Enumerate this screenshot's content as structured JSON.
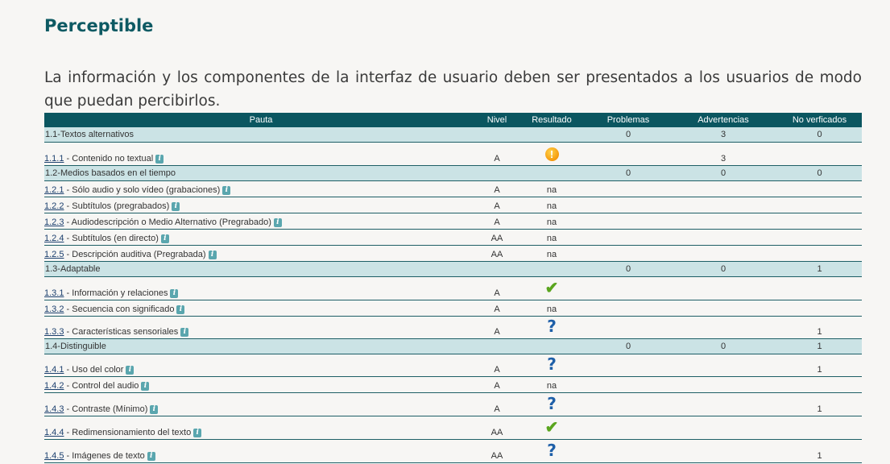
{
  "section_title": "Perceptible",
  "intro": "La información y los componentes de la interfaz de usuario deben ser presentados a los usuarios de modo que puedan percibirlos.",
  "colors": {
    "header_bg": "#0b5660",
    "group_bg": "#cbe3e5",
    "title": "#0e5a63"
  },
  "table": {
    "headers": {
      "pauta": "Pauta",
      "nivel": "Nivel",
      "resultado": "Resultado",
      "problemas": "Problemas",
      "advertencias": "Advertencias",
      "no_verificados": "No verficados"
    },
    "rows": [
      {
        "type": "group",
        "name": "1.1-Textos alternativos",
        "problemas": "0",
        "advertencias": "3",
        "no_verificados": "0"
      },
      {
        "type": "item",
        "code": "1.1.1",
        "name": " - Contenido no textual",
        "nivel": "A",
        "resultado": "",
        "icon": "warning-icon",
        "problemas": "",
        "advertencias": "3",
        "no_verificados": ""
      },
      {
        "type": "group",
        "name": "1.2-Medios basados en el tiempo",
        "problemas": "0",
        "advertencias": "0",
        "no_verificados": "0"
      },
      {
        "type": "item",
        "code": "1.2.1",
        "name": " - Sólo audio y solo vídeo (grabaciones)",
        "nivel": "A",
        "resultado": "na",
        "icon": "",
        "problemas": "",
        "advertencias": "",
        "no_verificados": ""
      },
      {
        "type": "item",
        "code": "1.2.2",
        "name": " - Subtítulos (pregrabados)",
        "nivel": "A",
        "resultado": "na",
        "icon": "",
        "problemas": "",
        "advertencias": "",
        "no_verificados": ""
      },
      {
        "type": "item",
        "code": "1.2.3",
        "name": " - Audiodescripción o Medio Alternativo (Pregrabado)",
        "nivel": "A",
        "resultado": "na",
        "icon": "",
        "problemas": "",
        "advertencias": "",
        "no_verificados": ""
      },
      {
        "type": "item",
        "code": "1.2.4",
        "name": " - Subtítulos (en directo)",
        "nivel": "AA",
        "resultado": "na",
        "icon": "",
        "problemas": "",
        "advertencias": "",
        "no_verificados": ""
      },
      {
        "type": "item",
        "code": "1.2.5",
        "name": " - Descripción auditiva (Pregrabada)",
        "nivel": "AA",
        "resultado": "na",
        "icon": "",
        "problemas": "",
        "advertencias": "",
        "no_verificados": ""
      },
      {
        "type": "group",
        "name": "1.3-Adaptable",
        "problemas": "0",
        "advertencias": "0",
        "no_verificados": "1"
      },
      {
        "type": "item",
        "code": "1.3.1",
        "name": " - Información y relaciones",
        "nivel": "A",
        "resultado": "",
        "icon": "check-icon",
        "problemas": "",
        "advertencias": "",
        "no_verificados": ""
      },
      {
        "type": "item",
        "code": "1.3.2",
        "name": " - Secuencia con significado",
        "nivel": "A",
        "resultado": "na",
        "icon": "",
        "problemas": "",
        "advertencias": "",
        "no_verificados": ""
      },
      {
        "type": "item",
        "code": "1.3.3",
        "name": " - Características sensoriales",
        "nivel": "A",
        "resultado": "",
        "icon": "question-icon",
        "problemas": "",
        "advertencias": "",
        "no_verificados": "1"
      },
      {
        "type": "group",
        "name": "1.4-Distinguible",
        "problemas": "0",
        "advertencias": "0",
        "no_verificados": "1"
      },
      {
        "type": "item",
        "code": "1.4.1",
        "name": " - Uso del color",
        "nivel": "A",
        "resultado": "",
        "icon": "question-icon",
        "problemas": "",
        "advertencias": "",
        "no_verificados": "1"
      },
      {
        "type": "item",
        "code": "1.4.2",
        "name": " - Control del audio",
        "nivel": "A",
        "resultado": "na",
        "icon": "",
        "problemas": "",
        "advertencias": "",
        "no_verificados": ""
      },
      {
        "type": "item",
        "code": "1.4.3",
        "name": " - Contraste (Mínimo)",
        "nivel": "A",
        "resultado": "",
        "icon": "question-icon",
        "problemas": "",
        "advertencias": "",
        "no_verificados": "1"
      },
      {
        "type": "item",
        "code": "1.4.4",
        "name": " - Redimensionamiento del texto",
        "nivel": "AA",
        "resultado": "",
        "icon": "check-icon",
        "problemas": "",
        "advertencias": "",
        "no_verificados": ""
      },
      {
        "type": "item",
        "code": "1.4.5",
        "name": " - Imágenes de texto",
        "nivel": "AA",
        "resultado": "",
        "icon": "question-icon",
        "problemas": "",
        "advertencias": "",
        "no_verificados": "1"
      }
    ]
  }
}
